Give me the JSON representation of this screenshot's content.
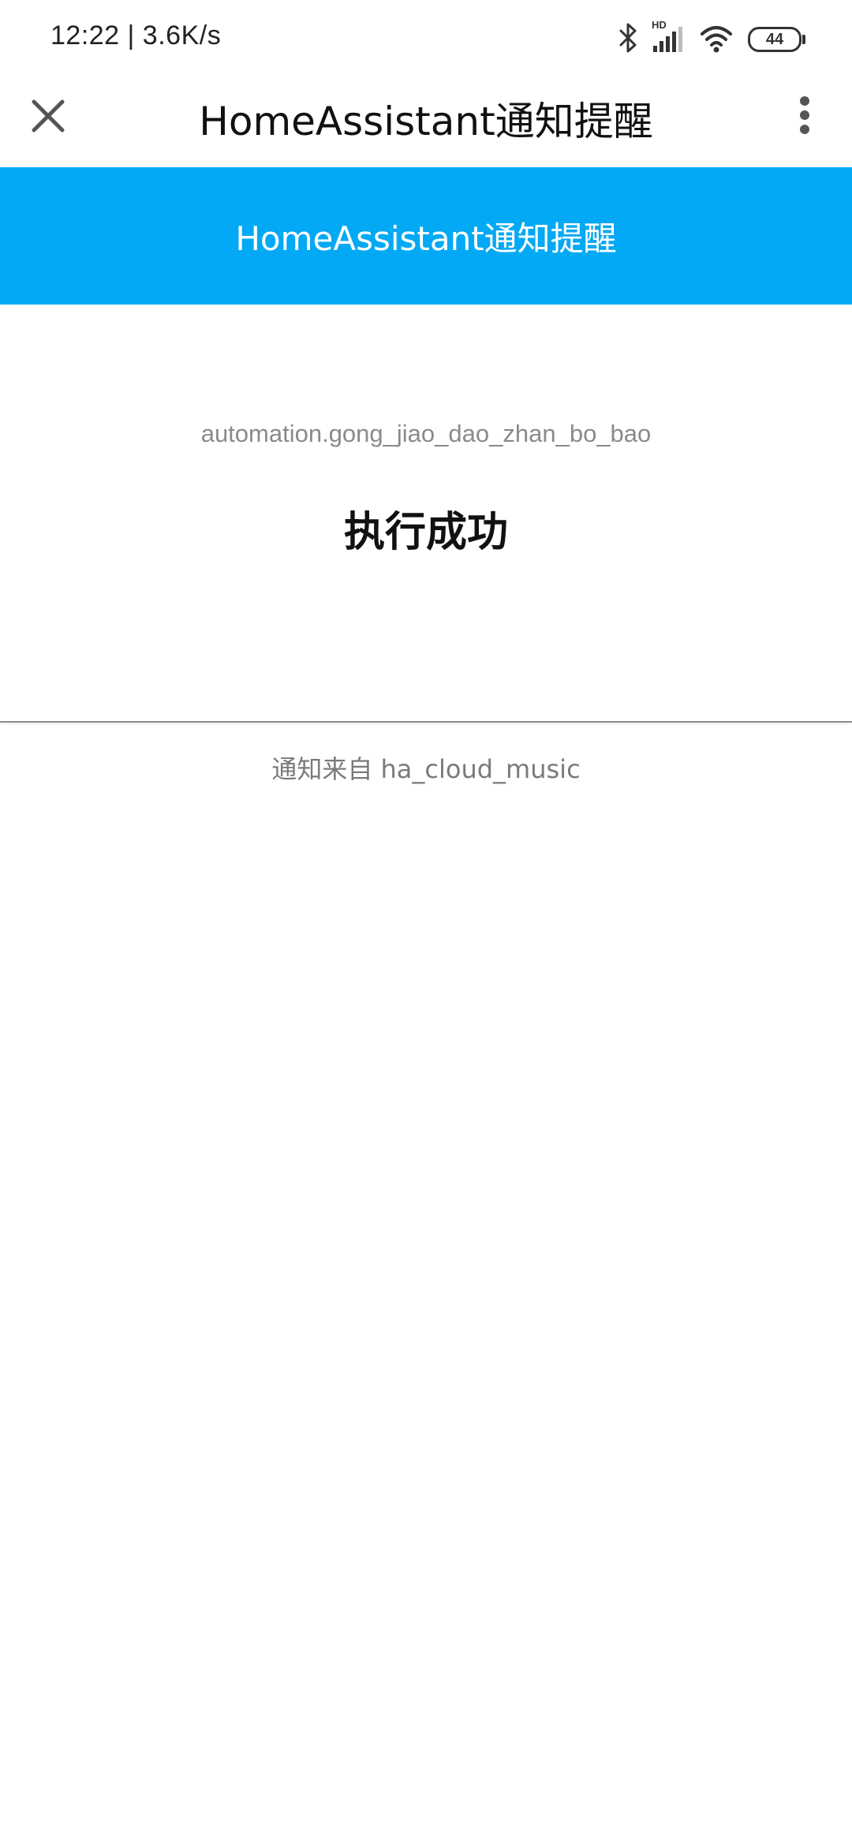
{
  "status_bar": {
    "time_speed": "12:22 | 3.6K/s",
    "network_badge": "HD",
    "battery_level": "44",
    "icons": [
      "bluetooth-icon",
      "signal-icon",
      "wifi-icon",
      "battery-icon"
    ]
  },
  "app_bar": {
    "title": "HomeAssistant通知提醒",
    "close_icon": "close-icon",
    "more_icon": "more-vert-icon"
  },
  "header": {
    "title": "HomeAssistant通知提醒",
    "background_color": "#03a9f4"
  },
  "content": {
    "entity_id": "automation.gong_jiao_dao_zhan_bo_bao",
    "message": "执行成功"
  },
  "footer": {
    "text": "通知来自 ha_cloud_music"
  }
}
